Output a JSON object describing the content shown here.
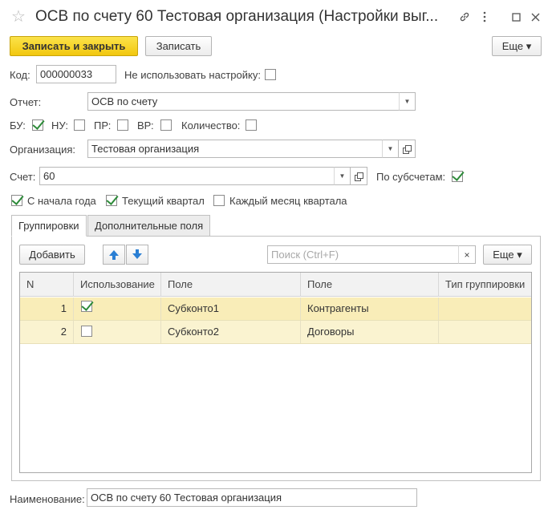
{
  "window": {
    "title": "ОСВ по счету 60 Тестовая организация (Настройки выг...",
    "star_icon": "star-icon",
    "link_icon": "link-icon",
    "menu_icon": "more-vertical-icon",
    "maximize_icon": "maximize-icon",
    "close_icon": "close-icon"
  },
  "toolbar": {
    "save_close_label": "Записать и закрыть",
    "save_label": "Записать",
    "more_label": "Еще ▾"
  },
  "form": {
    "code_label": "Код:",
    "code_value": "000000033",
    "no_use_label": "Не использовать настройку:",
    "no_use_checked": false,
    "report_label": "Отчет:",
    "report_value": "ОСВ по счету",
    "bu_label": "БУ:",
    "bu_checked": true,
    "nu_label": "НУ:",
    "nu_checked": false,
    "pr_label": "ПР:",
    "pr_checked": false,
    "vr_label": "ВР:",
    "vr_checked": false,
    "qty_label": "Количество:",
    "qty_checked": false,
    "org_label": "Организация:",
    "org_value": "Тестовая организация",
    "account_label": "Счет:",
    "account_value": "60",
    "subaccounts_label": "По субсчетам:",
    "subaccounts_checked": true,
    "from_year_start_label": "С начала года",
    "from_year_start_checked": true,
    "current_quarter_label": "Текущий квартал",
    "current_quarter_checked": true,
    "each_month_label": "Каждый месяц квартала",
    "each_month_checked": false,
    "name_label": "Наименование:",
    "name_value": "ОСВ по счету 60 Тестовая организация"
  },
  "tabs": [
    {
      "label": "Группировки",
      "active": true
    },
    {
      "label": "Дополнительные поля",
      "active": false
    }
  ],
  "grid_toolbar": {
    "add_label": "Добавить",
    "search_placeholder": "Поиск (Ctrl+F)",
    "clear_label": "×",
    "more_label": "Еще ▾"
  },
  "grid": {
    "columns": [
      "N",
      "Использование",
      "Поле",
      "Поле",
      "Тип группировки"
    ],
    "rows": [
      {
        "n": "1",
        "use": true,
        "field1": "Субконто1",
        "field2": "Контрагенты",
        "type": ""
      },
      {
        "n": "2",
        "use": false,
        "field1": "Субконто2",
        "field2": "Договоры",
        "type": ""
      }
    ]
  },
  "colors": {
    "primary_button": "#f2c70f",
    "check_green": "#2e8b3a",
    "row_highlight": "#faf3d0",
    "arrow_blue": "#2a7fd4"
  }
}
